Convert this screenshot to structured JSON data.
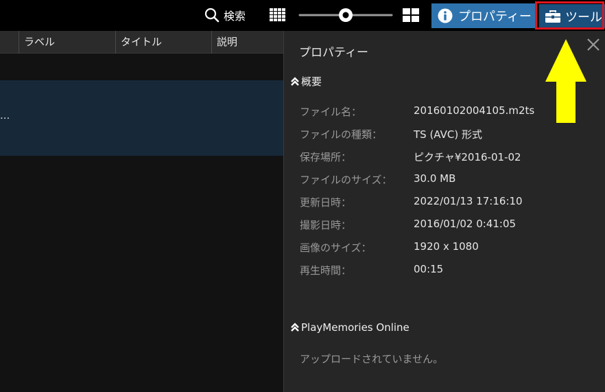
{
  "toolbar": {
    "search_label": "検索",
    "properties_label": "プロパティー",
    "tools_label": "ツール",
    "zoom_level": 0.5
  },
  "list": {
    "columns": [
      {
        "label": "ラベル"
      },
      {
        "label": "タイトル"
      },
      {
        "label": "説明"
      }
    ],
    "selected_row_text": "..."
  },
  "panel": {
    "title": "プロパティー",
    "summary_heading": "概要",
    "properties": [
      {
        "label": "ファイル名：",
        "value": "20160102004105.m2ts"
      },
      {
        "label": "ファイルの種類：",
        "value": "TS (AVC) 形式"
      },
      {
        "label": "保存場所：",
        "value": "ピクチャ¥2016-01-02"
      },
      {
        "label": "ファイルのサイズ：",
        "value": "30.0 MB"
      },
      {
        "label": "更新日時：",
        "value": "2022/01/13 17:16:10"
      },
      {
        "label": "撮影日時：",
        "value": "2016/01/02 0:41:05"
      },
      {
        "label": "画像のサイズ：",
        "value": "1920 x 1080"
      },
      {
        "label": "再生時間：",
        "value": "00:15"
      }
    ],
    "playmemories_heading": "PlayMemories Online",
    "playmemories_status": "アップロードされていません。"
  },
  "icons": {
    "search": "search-icon",
    "grid_small": "grid-small-icon",
    "grid_large": "grid-large-icon",
    "info": "info-icon",
    "toolbox": "toolbox-icon",
    "close": "close-icon",
    "collapse": "chevron-double-up-icon"
  },
  "colors": {
    "properties_button": "#2e73ae",
    "tools_button": "#1b4f7c",
    "highlight_box": "#e0141e",
    "annotation_arrow": "#ffff00",
    "selected_row": "#172838",
    "panel_bg": "#262626"
  }
}
